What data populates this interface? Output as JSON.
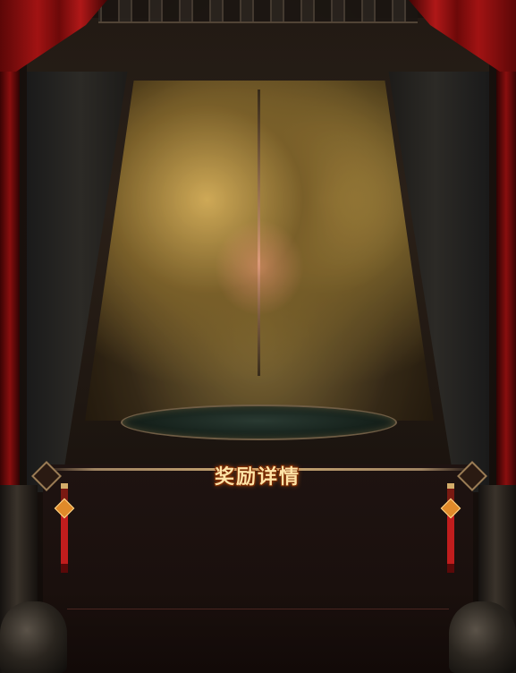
{
  "dialog": {
    "title": "奖励详情"
  },
  "scene": {
    "background": "altar-stage",
    "accent_color": "#ffe3a6",
    "curtain_color": "#a11313"
  }
}
